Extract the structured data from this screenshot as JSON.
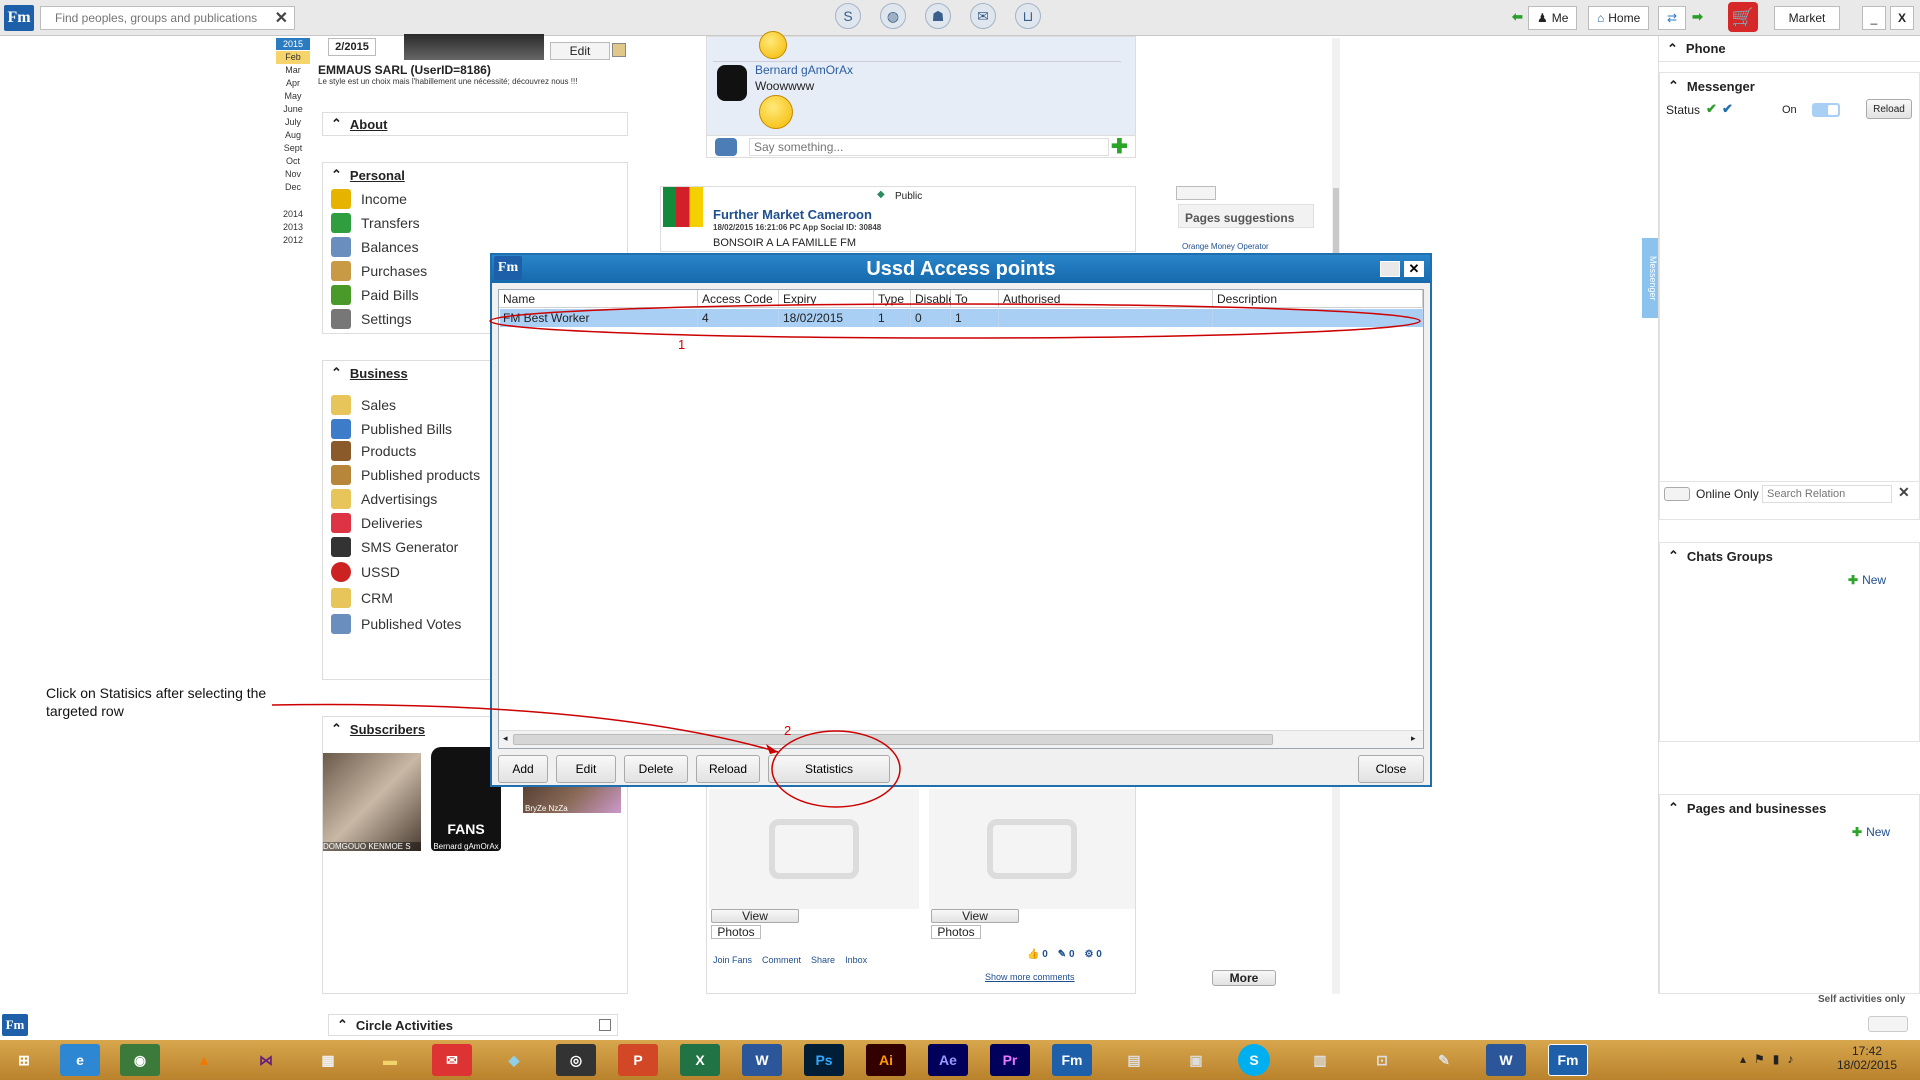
{
  "topbar": {
    "logo": "Fm",
    "search_placeholder": "Find peoples, groups and publications",
    "me_label": "Me",
    "home_label": "Home",
    "market_label": "Market",
    "minimize": "_",
    "close": "X"
  },
  "calendar": {
    "months": [
      "Feb",
      "Mar",
      "Apr",
      "May",
      "June",
      "July",
      "Aug",
      "Sept",
      "Oct",
      "Nov",
      "Dec"
    ],
    "years": [
      "2014",
      "2013",
      "2012"
    ],
    "current_year": "2015",
    "date_label": "2/2015"
  },
  "profile": {
    "edit_label": "Edit",
    "name": "EMMAUS SARL (UserID=8186)",
    "slogan": "Le style est un choix mais l'habillement une nécessité; découvrez nous !!!"
  },
  "about": {
    "label": "About"
  },
  "personal": {
    "label": "Personal",
    "items": [
      "Income",
      "Transfers",
      "Balances",
      "Purchases",
      "Paid Bills",
      "Settings"
    ]
  },
  "business": {
    "label": "Business",
    "items": [
      "Sales",
      "Published Bills",
      "Products",
      "Published products",
      "Advertisings",
      "Deliveries",
      "SMS Generator",
      "USSD",
      "CRM",
      "Published Votes"
    ]
  },
  "subscribers": {
    "label": "Subscribers",
    "items": [
      "DOMGOUO KENMOE S",
      "Bernard gAmOrAx",
      "BryZe NzZa"
    ],
    "fans_label": "FANS"
  },
  "circle": {
    "label": "Circle Activities"
  },
  "feed": {
    "comment_author": "Bernard gAmOrAx",
    "comment_text": "Woowwww",
    "say_placeholder": "Say something...",
    "post_visibility": "Public",
    "post_author": "Further Market Cameroon",
    "post_meta": "18/02/2015 16:21:06  PC App  Social ID: 30848",
    "post_text": "BONSOIR A LA FAMILLE FM",
    "view_label": "View",
    "photos_label": "Photos",
    "actions": [
      "Join Fans",
      "Comment",
      "Share",
      "Inbox"
    ],
    "counts": [
      "0",
      "0",
      "0"
    ],
    "show_more": "Show more comments",
    "more_btn": "More",
    "suggestions_title": "Pages suggestions",
    "suggestion_1": "Orange Money Operator"
  },
  "dialog": {
    "title": "Ussd Access points",
    "columns": [
      "Name",
      "Access Code",
      "Expiry",
      "Type",
      "Disabled",
      "To Public",
      "Authorised",
      "Description"
    ],
    "rows": [
      [
        "FM Best Worker",
        "4",
        "18/02/2015",
        "1",
        "0",
        "1",
        "",
        ""
      ]
    ],
    "buttons": {
      "add": "Add",
      "edit": "Edit",
      "delete": "Delete",
      "reload": "Reload",
      "statistics": "Statistics",
      "close": "Close"
    }
  },
  "annotations": {
    "marker_1": "1",
    "marker_2": "2",
    "instruction": "Click on Statisics after selecting the targeted row"
  },
  "right": {
    "phone": "Phone",
    "messenger": "Messenger",
    "status_label": "Status",
    "on_label": "On",
    "reload": "Reload",
    "vertical_tab": "Messenger",
    "online_only": "Online Only",
    "search_relation_placeholder": "Search Relation",
    "chats_groups": "Chats Groups",
    "new_label": "New",
    "pages_businesses": "Pages and businesses",
    "self_activities": "Self activities only"
  },
  "taskbar": {
    "time": "17:42",
    "date": "18/02/2015"
  },
  "colors": {
    "accent": "#1d6fb0",
    "selection": "#a9cff5",
    "annotation": "#cc0000",
    "taskbar": "#c8913a"
  }
}
